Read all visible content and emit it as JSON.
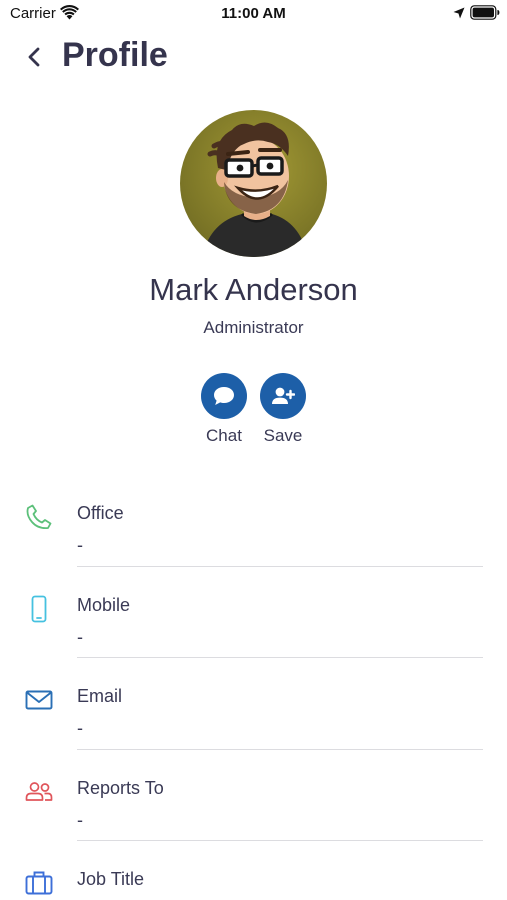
{
  "status_bar": {
    "carrier": "Carrier",
    "time": "11:00 AM"
  },
  "header": {
    "title": "Profile"
  },
  "profile": {
    "name": "Mark Anderson",
    "role": "Administrator"
  },
  "actions": [
    {
      "label": "Chat",
      "icon": "chat-bubble-icon"
    },
    {
      "label": "Save",
      "icon": "add-contact-icon"
    }
  ],
  "details": [
    {
      "label": "Office",
      "value": "-",
      "icon": "phone-icon",
      "color": "#5cc07a"
    },
    {
      "label": "Mobile",
      "value": "-",
      "icon": "mobile-icon",
      "color": "#45c1e0"
    },
    {
      "label": "Email",
      "value": "-",
      "icon": "envelope-icon",
      "color": "#2a6fb5"
    },
    {
      "label": "Reports To",
      "value": "-",
      "icon": "people-icon",
      "color": "#e0555b"
    },
    {
      "label": "Job Title",
      "value": "",
      "icon": "briefcase-icon",
      "color": "#3d6fd8"
    }
  ],
  "colors": {
    "title": "#35344d",
    "accent": "#1d5fa8",
    "divider": "#dcdce0"
  }
}
